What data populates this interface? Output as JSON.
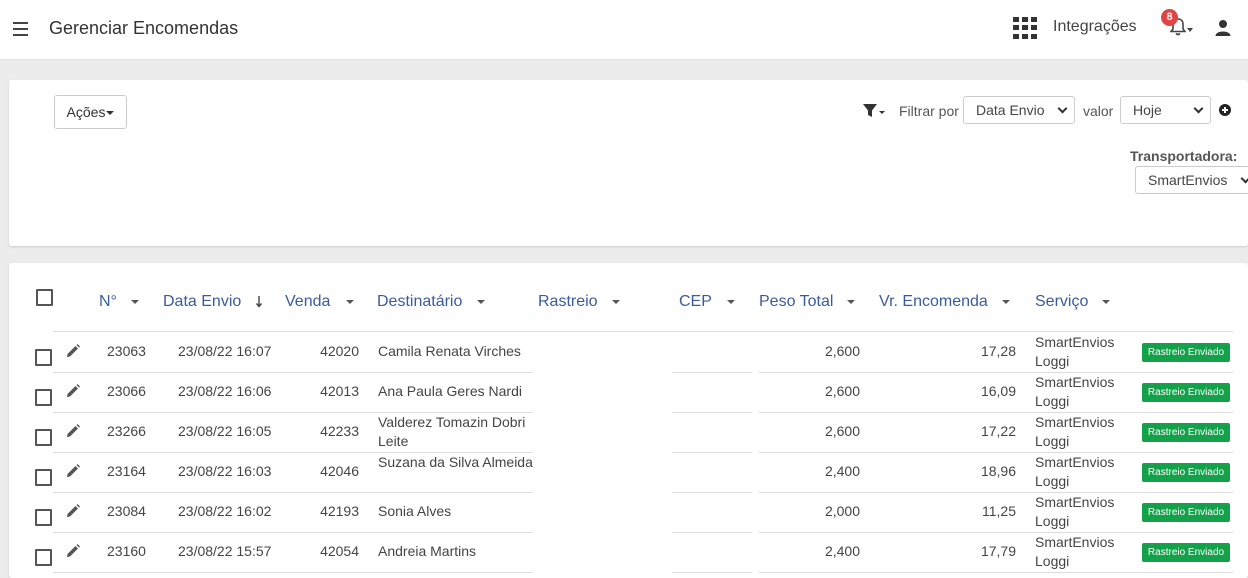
{
  "header": {
    "title": "Gerenciar Encomendas",
    "integrations_label": "Integrações",
    "notifications_count": "8"
  },
  "filters": {
    "actions_label": "Ações",
    "filter_by_label": "Filtrar por",
    "filter_field": "Data Envio",
    "value_label": "valor",
    "filter_value": "Hoje",
    "carrier_label": "Transportadora:",
    "carrier_value": "SmartEnvios"
  },
  "table": {
    "columns": [
      "N°",
      "Data Envio",
      "Venda",
      "Destinatário",
      "Rastreio",
      "CEP",
      "Peso Total",
      "Vr. Encomenda",
      "Serviço"
    ],
    "rows": [
      {
        "num": "23063",
        "date": "23/08/22 16:07",
        "venda": "42020",
        "dest": "Camila Renata Virches",
        "peso": "2,600",
        "valor": "17,28",
        "servico_1": "SmartEnvios",
        "servico_2": "Loggi",
        "status": "Rastreio Enviado"
      },
      {
        "num": "23066",
        "date": "23/08/22 16:06",
        "venda": "42013",
        "dest": "Ana Paula Geres Nardi",
        "peso": "2,600",
        "valor": "16,09",
        "servico_1": "SmartEnvios",
        "servico_2": "Loggi",
        "status": "Rastreio Enviado"
      },
      {
        "num": "23266",
        "date": "23/08/22 16:05",
        "venda": "42233",
        "dest": "Valderez Tomazin Dobri Leite",
        "peso": "2,600",
        "valor": "17,22",
        "servico_1": "SmartEnvios",
        "servico_2": "Loggi",
        "status": "Rastreio Enviado"
      },
      {
        "num": "23164",
        "date": "23/08/22 16:03",
        "venda": "42046",
        "dest": "Suzana da Silva Almeida",
        "peso": "2,400",
        "valor": "18,96",
        "servico_1": "SmartEnvios",
        "servico_2": "Loggi",
        "status": "Rastreio Enviado"
      },
      {
        "num": "23084",
        "date": "23/08/22 16:02",
        "venda": "42193",
        "dest": "Sonia Alves",
        "peso": "2,000",
        "valor": "11,25",
        "servico_1": "SmartEnvios",
        "servico_2": "Loggi",
        "status": "Rastreio Enviado"
      },
      {
        "num": "23160",
        "date": "23/08/22 15:57",
        "venda": "42054",
        "dest": "Andreia Martins",
        "peso": "2,400",
        "valor": "17,79",
        "servico_1": "SmartEnvios",
        "servico_2": "Loggi",
        "status": "Rastreio Enviado"
      }
    ]
  },
  "colors": {
    "status_green": "#13a24a",
    "header_link": "#3a5ba0",
    "badge_red": "#e24444"
  }
}
